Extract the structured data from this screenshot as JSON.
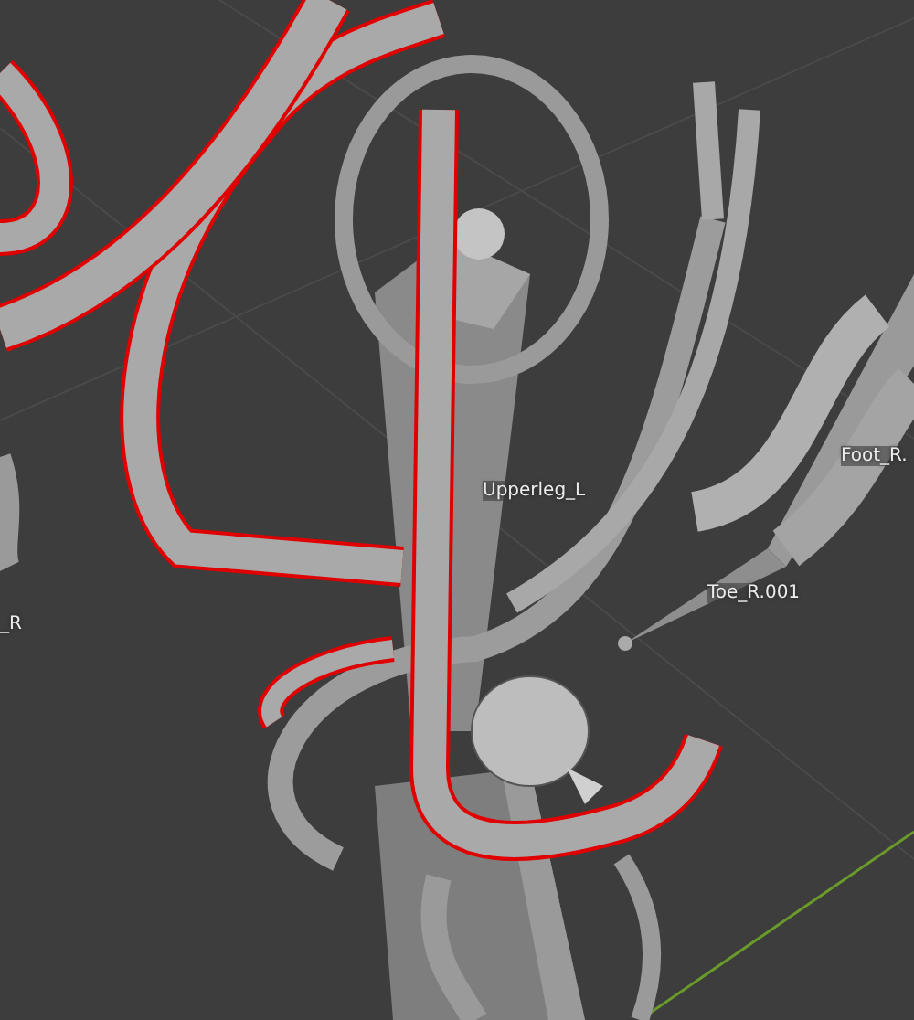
{
  "viewport": {
    "bone_labels": [
      {
        "text": "Upperleg_L"
      },
      {
        "text": "Foot_R."
      },
      {
        "text": "Toe_R.001"
      },
      {
        "text": "_R"
      }
    ]
  }
}
